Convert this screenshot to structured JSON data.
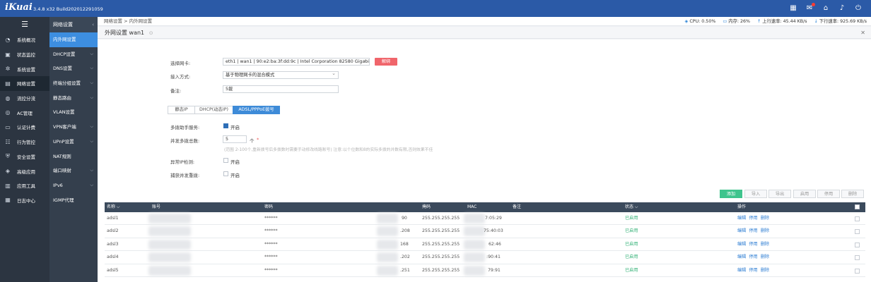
{
  "topbar": {
    "logo": "iKuai",
    "version": "3.4.8 x32 Build202012291059"
  },
  "sidebar": {
    "items": [
      {
        "label": "系统概况",
        "icon": "gauge-icon"
      },
      {
        "label": "状态监控",
        "icon": "monitor-icon"
      },
      {
        "label": "系统设置",
        "icon": "gear-icon"
      },
      {
        "label": "网络设置",
        "icon": "network-icon"
      },
      {
        "label": "流控分流",
        "icon": "flow-icon"
      },
      {
        "label": "AC管理",
        "icon": "ac-icon"
      },
      {
        "label": "认证计费",
        "icon": "auth-icon"
      },
      {
        "label": "行为管控",
        "icon": "behavior-icon"
      },
      {
        "label": "安全设置",
        "icon": "shield-icon"
      },
      {
        "label": "高级应用",
        "icon": "advanced-icon"
      },
      {
        "label": "应用工具",
        "icon": "tools-icon"
      },
      {
        "label": "日志中心",
        "icon": "log-icon"
      }
    ]
  },
  "submenu": {
    "title": "网络设置",
    "items": [
      {
        "label": "内外网设置"
      },
      {
        "label": "DHCP设置"
      },
      {
        "label": "DNS设置"
      },
      {
        "label": "终端分组设置"
      },
      {
        "label": "静态路由"
      },
      {
        "label": "VLAN设置"
      },
      {
        "label": "VPN客户端"
      },
      {
        "label": "UPnP设置"
      },
      {
        "label": "NAT规则"
      },
      {
        "label": "端口映射"
      },
      {
        "label": "IPv6"
      },
      {
        "label": "IGMP代理"
      }
    ]
  },
  "breadcrumb": "网络设置 > 内外网设置",
  "stats": {
    "cpu": "CPU: 0.50%",
    "mem": "内存: 26%",
    "up": "上行速率: 45.44 KB/s",
    "down": "下行速率: 925.69 KB/s"
  },
  "tab": {
    "title": "外网设置  wan1"
  },
  "form": {
    "nic_label": "选择网卡:",
    "nic_value": "eth1 | wan1 | 90:e2:ba:3f:dd:9c | Intel Corporation 82580 Gigabit Net",
    "delete_label": "解绑",
    "mode_label": "接入方式:",
    "mode_value": "基于物理网卡的混合模式",
    "note_label": "备注:",
    "note_value": "5拨",
    "tabs": [
      "静态IP",
      "DHCP(动态IP)",
      "ADSL/PPPoE拨号"
    ],
    "multi_label": "多拨助手服务:",
    "multi_value": "开启",
    "concurrent_label": "并发多拨总数:",
    "concurrent_value": "5",
    "concurrent_unit": "个",
    "required_mark": "*",
    "hint": "(范围 2-100个,重新拨号后多拨数时需要手动修改线路账号) 注意:以个位数和8的实际多拨的并数有限,否则效果不佳",
    "abnormal_label": "异常IP检测:",
    "abnormal_value": "开启",
    "capture_label": "捕获并发重拨:",
    "capture_value": "开启"
  },
  "actions": [
    "添加",
    "导入",
    "导出",
    "启用",
    "停用",
    "删除"
  ],
  "table": {
    "headers": [
      "名称 ⌵",
      "账号",
      "密码",
      "",
      "掩码",
      "MAC",
      "备注",
      "状态 ⌵",
      "操作"
    ],
    "rows": [
      {
        "name": "adsl1",
        "pwd": "******",
        "ip_tail": "90",
        "mask": "255.255.255.255",
        "mac_tail": "7:05:29",
        "status": "已启用"
      },
      {
        "name": "adsl2",
        "pwd": "******",
        "ip_tail": ".208",
        "mask": "255.255.255.255",
        "mac_tail": "75:40:03",
        "status": "已启用"
      },
      {
        "name": "adsl3",
        "pwd": "******",
        "ip_tail": "168",
        "mask": "255.255.255.255",
        "mac_tail": "62:46",
        "status": "已启用"
      },
      {
        "name": "adsl4",
        "pwd": "******",
        "ip_tail": ".202",
        "mask": "255.255.255.255",
        "mac_tail": ":90:41",
        "status": "已启用"
      },
      {
        "name": "adsl5",
        "pwd": "******",
        "ip_tail": ".251",
        "mask": "255.255.255.255",
        "mac_tail": "79:91",
        "status": "已启用"
      }
    ],
    "ops": [
      "编辑",
      "停用",
      "删除"
    ]
  }
}
